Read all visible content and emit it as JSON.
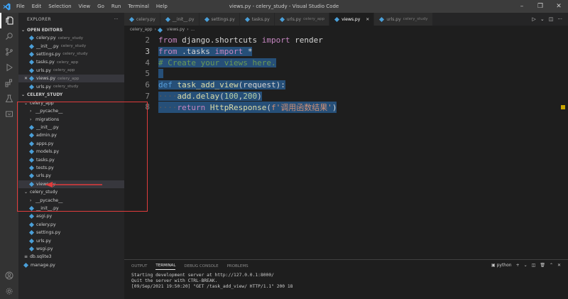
{
  "menu": [
    "File",
    "Edit",
    "Selection",
    "View",
    "Go",
    "Run",
    "Terminal",
    "Help"
  ],
  "window_title": "views.py - celery_study - Visual Studio Code",
  "sidebar": {
    "header": "EXPLORER",
    "open_editors_label": "OPEN EDITORS",
    "open_editors": [
      {
        "name": "celery.py",
        "dir": "celery_study"
      },
      {
        "name": "__init__.py",
        "dir": "celery_study"
      },
      {
        "name": "settings.py",
        "dir": "celery_study"
      },
      {
        "name": "tasks.py",
        "dir": "celery_app"
      },
      {
        "name": "urls.py",
        "dir": "celery_app"
      },
      {
        "name": "views.py",
        "dir": "celery_app"
      },
      {
        "name": "urls.py",
        "dir": "celery_study"
      }
    ],
    "project_label": "CELERY_STUDY",
    "tree": [
      {
        "name": "celery_app",
        "type": "folder-open",
        "indent": 1
      },
      {
        "name": "__pycache__",
        "type": "folder",
        "indent": 2
      },
      {
        "name": "migrations",
        "type": "folder",
        "indent": 2
      },
      {
        "name": "__init__.py",
        "type": "py",
        "indent": 2
      },
      {
        "name": "admin.py",
        "type": "py",
        "indent": 2
      },
      {
        "name": "apps.py",
        "type": "py",
        "indent": 2
      },
      {
        "name": "models.py",
        "type": "py",
        "indent": 2
      },
      {
        "name": "tasks.py",
        "type": "py",
        "indent": 2
      },
      {
        "name": "tests.py",
        "type": "py",
        "indent": 2
      },
      {
        "name": "urls.py",
        "type": "py",
        "indent": 2
      },
      {
        "name": "views.py",
        "type": "py",
        "indent": 2,
        "selected": true
      },
      {
        "name": "celery_study",
        "type": "folder-open",
        "indent": 1
      },
      {
        "name": "__pycache__",
        "type": "folder",
        "indent": 2
      },
      {
        "name": "__init__.py",
        "type": "py",
        "indent": 2
      },
      {
        "name": "asgi.py",
        "type": "py",
        "indent": 2
      },
      {
        "name": "celery.py",
        "type": "py",
        "indent": 2
      },
      {
        "name": "settings.py",
        "type": "py",
        "indent": 2
      },
      {
        "name": "urls.py",
        "type": "py",
        "indent": 2
      },
      {
        "name": "wsgi.py",
        "type": "py",
        "indent": 2
      },
      {
        "name": "db.sqlite3",
        "type": "db",
        "indent": 1
      },
      {
        "name": "manage.py",
        "type": "py",
        "indent": 1
      }
    ]
  },
  "tabs": [
    {
      "name": "celery.py",
      "dir": ""
    },
    {
      "name": "__init__.py",
      "dir": ""
    },
    {
      "name": "settings.py",
      "dir": ""
    },
    {
      "name": "tasks.py",
      "dir": ""
    },
    {
      "name": "urls.py",
      "dir": "celery_app"
    },
    {
      "name": "views.py",
      "dir": "",
      "active": true
    },
    {
      "name": "urls.py",
      "dir": "celery_study"
    }
  ],
  "breadcrumb": {
    "folder": "celery_app",
    "file": "views.py",
    "rest": "..."
  },
  "editor": {
    "lines": [
      {
        "n": "2",
        "indent": "",
        "tokens": [
          [
            "kw",
            "from"
          ],
          [
            "id",
            " django.shortcuts "
          ],
          [
            "kw",
            "import"
          ],
          [
            "id",
            " render"
          ]
        ],
        "sel": false
      },
      {
        "n": "3",
        "indent": "",
        "tokens": [
          [
            "kw",
            "from"
          ],
          [
            "id",
            " .tasks "
          ],
          [
            "kw",
            "import"
          ],
          [
            "id",
            " *"
          ]
        ],
        "sel": true
      },
      {
        "n": "4",
        "indent": "",
        "tokens": [
          [
            "cm",
            "# Create your views here."
          ]
        ],
        "sel": true
      },
      {
        "n": "5",
        "indent": "",
        "tokens": [],
        "sel": true
      },
      {
        "n": "6",
        "indent": "",
        "tokens": [
          [
            "def",
            "def"
          ],
          [
            "fn",
            " task_add_view"
          ],
          [
            "id",
            "(request):"
          ]
        ],
        "sel": true
      },
      {
        "n": "7",
        "indent": "····",
        "tokens": [
          [
            "fn",
            "add.delay"
          ],
          [
            "id",
            "("
          ],
          [
            "num",
            "100"
          ],
          [
            "id",
            ","
          ],
          [
            "num",
            "200"
          ],
          [
            "id",
            ")"
          ]
        ],
        "sel": true
      },
      {
        "n": "8",
        "indent": "····",
        "tokens": [
          [
            "kw",
            "return"
          ],
          [
            "fn",
            " HttpResponse"
          ],
          [
            "id",
            "("
          ],
          [
            "str",
            "f'调用函数结果'"
          ],
          [
            "id",
            ")"
          ]
        ],
        "sel": true
      }
    ]
  },
  "panel": {
    "tabs": [
      "OUTPUT",
      "TERMINAL",
      "DEBUG CONSOLE",
      "PROBLEMS"
    ],
    "active_tab": "TERMINAL",
    "shell": "python",
    "terminal_lines": [
      "Starting development server at http://127.0.0.1:8000/",
      "Quit the server with CTRL-BREAK.",
      "[09/Sep/2021 19:50:20] \"GET /task_add_view/ HTTP/1.1\" 200 18"
    ]
  },
  "colors": {
    "annotation": "#e03c3c",
    "selection": "#264f78",
    "accent": "#007acc"
  }
}
